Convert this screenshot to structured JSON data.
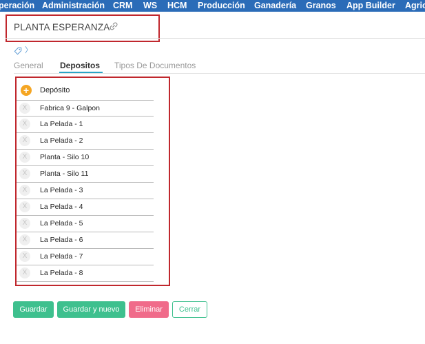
{
  "topnav": {
    "items": [
      "peración",
      "Administración",
      "CRM",
      "WS",
      "HCM",
      "Producción",
      "Ganadería",
      "Granos",
      "App Builder",
      "Agric"
    ]
  },
  "record": {
    "title": "PLANTA ESPERANZA",
    "link_icon": "link-icon"
  },
  "tag": {
    "icon": "tag-icon",
    "chevron": "〉"
  },
  "tabs": [
    {
      "label": "General",
      "active": false
    },
    {
      "label": "Depositos",
      "active": true
    },
    {
      "label": "Tipos De Documentos",
      "active": false
    }
  ],
  "depositos": {
    "add_icon": "+",
    "header": "Depósito",
    "remove_label": "X",
    "rows": [
      "Fabrica 9 - Galpon",
      "La Pelada - 1",
      "La Pelada - 2",
      "Planta - Silo 10",
      "Planta - Silo 11",
      "La Pelada - 3",
      "La Pelada - 4",
      "La Pelada - 5",
      "La Pelada - 6",
      "La Pelada - 7",
      "La Pelada - 8"
    ]
  },
  "actions": {
    "save": "Guardar",
    "save_new": "Guardar y nuevo",
    "delete": "Eliminar",
    "close": "Cerrar"
  },
  "colors": {
    "nav_bg": "#2b6cb8",
    "highlight_border": "#c0272d",
    "tab_accent": "#2aa4c7",
    "primary_green": "#3ec08e",
    "danger_pink": "#f06b8a",
    "add_orange": "#f5a623"
  }
}
